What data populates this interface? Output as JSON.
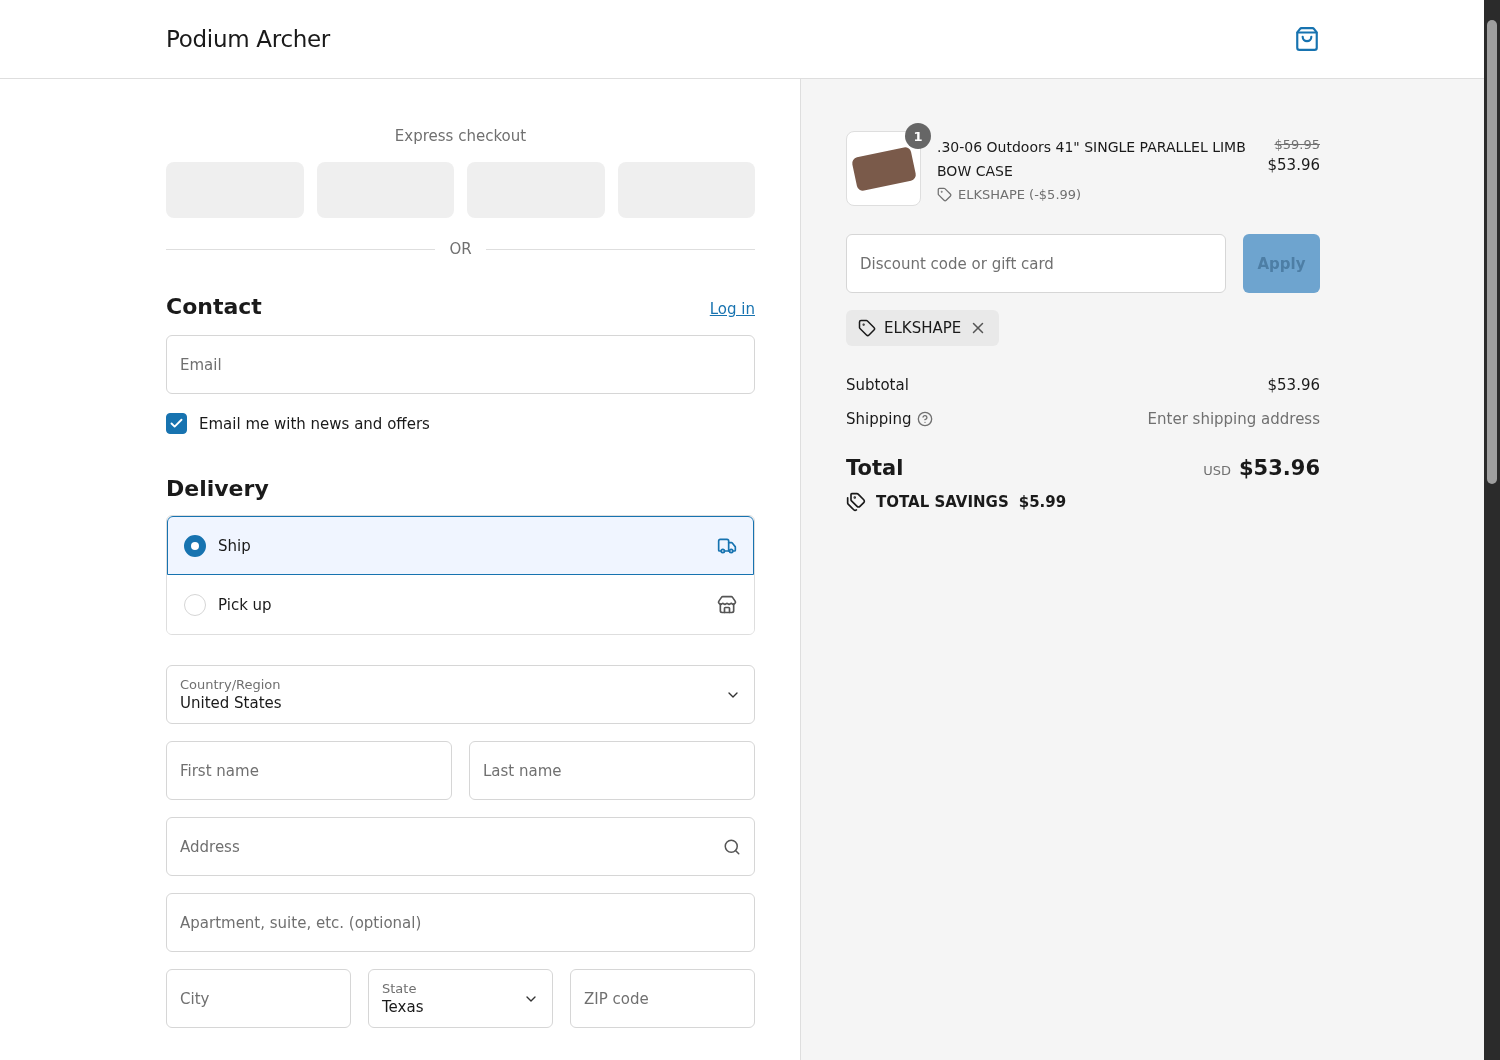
{
  "header": {
    "store_name": "Podium Archer"
  },
  "express_checkout": {
    "label": "Express checkout",
    "divider": "OR"
  },
  "contact": {
    "heading": "Contact",
    "login_link": "Log in",
    "email": {
      "placeholder": "Email"
    },
    "marketing": {
      "label": "Email me with news and offers",
      "checked": true
    }
  },
  "delivery": {
    "heading": "Delivery",
    "options": [
      {
        "label": "Ship",
        "selected": true,
        "kind": "ship"
      },
      {
        "label": "Pick up",
        "selected": false,
        "kind": "pickup"
      }
    ],
    "country": {
      "label": "Country/Region",
      "value": "United States"
    },
    "first_name": {
      "placeholder": "First name"
    },
    "last_name": {
      "placeholder": "Last name"
    },
    "address": {
      "placeholder": "Address"
    },
    "apartment": {
      "placeholder": "Apartment, suite, etc. (optional)"
    },
    "city": {
      "placeholder": "City"
    },
    "state": {
      "label": "State",
      "value": "Texas"
    },
    "zip": {
      "placeholder": "ZIP code"
    }
  },
  "summary": {
    "item": {
      "quantity": "1",
      "name": ".30-06 Outdoors 41\" SINGLE PARALLEL LIMB BOW CASE",
      "discount": "ELKSHAPE (-$5.99)",
      "original_price": "$59.95",
      "price": "$53.96"
    },
    "discount_field": {
      "placeholder": "Discount code or gift card"
    },
    "apply_button": {
      "label": "Apply",
      "disabled": true
    },
    "applied_code": "ELKSHAPE",
    "subtotal": {
      "label": "Subtotal",
      "value": "$53.96"
    },
    "shipping": {
      "label": "Shipping",
      "value": "Enter shipping address"
    },
    "total": {
      "label": "Total",
      "currency": "USD",
      "value": "$53.96"
    },
    "savings": {
      "label": "TOTAL SAVINGS",
      "value": "$5.99"
    }
  }
}
